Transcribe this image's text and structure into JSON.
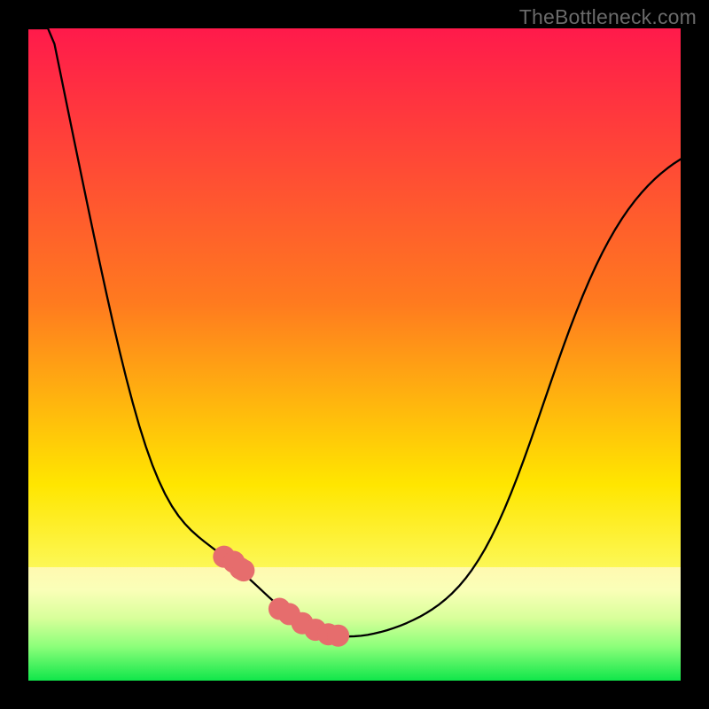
{
  "watermark": "TheBottleneck.com",
  "chart_data": {
    "type": "line",
    "title": "",
    "xlabel": "",
    "ylabel": "",
    "xlim": [
      0,
      100
    ],
    "ylim": [
      0,
      100
    ],
    "x": [
      0,
      1,
      2,
      3,
      4,
      5,
      6,
      7,
      8,
      9,
      10,
      11,
      12,
      13,
      14,
      15,
      16,
      17,
      18,
      19,
      20,
      21,
      22,
      23,
      24,
      25,
      26,
      27,
      28,
      29,
      30,
      31,
      32,
      33,
      34,
      35,
      36,
      37,
      38,
      39,
      40,
      41,
      42,
      43,
      44,
      45,
      46,
      47,
      48,
      49,
      50,
      51,
      52,
      53,
      54,
      55,
      56,
      57,
      58,
      59,
      60,
      61,
      62,
      63,
      64,
      65,
      66,
      67,
      68,
      69,
      70,
      71,
      72,
      73,
      74,
      75,
      76,
      77,
      78,
      79,
      80,
      81,
      82,
      83,
      84,
      85,
      86,
      87,
      88,
      89,
      90,
      91,
      92,
      93,
      94,
      95,
      96,
      97,
      98,
      99,
      100
    ],
    "y": [
      100.0,
      100.0,
      100.0,
      100.0,
      97.62,
      92.71,
      87.81,
      82.93,
      78.07,
      73.25,
      68.48,
      63.79,
      59.2,
      54.74,
      50.46,
      46.4,
      42.6,
      39.09,
      35.92,
      33.1,
      30.65,
      28.54,
      26.76,
      25.28,
      24.05,
      23.01,
      22.11,
      21.3,
      20.53,
      19.76,
      18.98,
      18.16,
      17.3,
      16.41,
      15.49,
      14.56,
      13.63,
      12.7,
      11.81,
      10.96,
      10.17,
      9.45,
      8.81,
      8.25,
      7.79,
      7.41,
      7.13,
      6.93,
      6.82,
      6.77,
      6.8,
      6.88,
      7.02,
      7.21,
      7.45,
      7.73,
      8.06,
      8.42,
      8.83,
      9.29,
      9.79,
      10.36,
      10.99,
      11.7,
      12.51,
      13.42,
      14.46,
      15.64,
      16.98,
      18.49,
      20.17,
      22.04,
      24.09,
      26.33,
      28.74,
      31.3,
      33.99,
      36.79,
      39.66,
      42.57,
      45.49,
      48.37,
      51.19,
      53.93,
      56.54,
      59.03,
      61.37,
      63.57,
      65.61,
      67.49,
      69.23,
      70.82,
      72.28,
      73.6,
      74.8,
      75.89,
      76.88,
      77.77,
      78.57,
      79.3,
      79.95
    ],
    "markers": {
      "x": [
        30,
        31.5,
        32.5,
        33,
        38.5,
        40,
        42,
        44,
        46,
        47.5
      ],
      "y": [
        19.0,
        18.2,
        17.2,
        16.9,
        11.0,
        10.2,
        8.8,
        7.8,
        7.1,
        6.9
      ]
    },
    "green_zone_y": [
      0,
      7.2
    ],
    "gradient": {
      "top": "#ff1a4b",
      "mid1": "#ff7a1f",
      "mid2": "#ffe600",
      "mid3": "#fbff7a",
      "bottom": "#10e64a"
    }
  }
}
